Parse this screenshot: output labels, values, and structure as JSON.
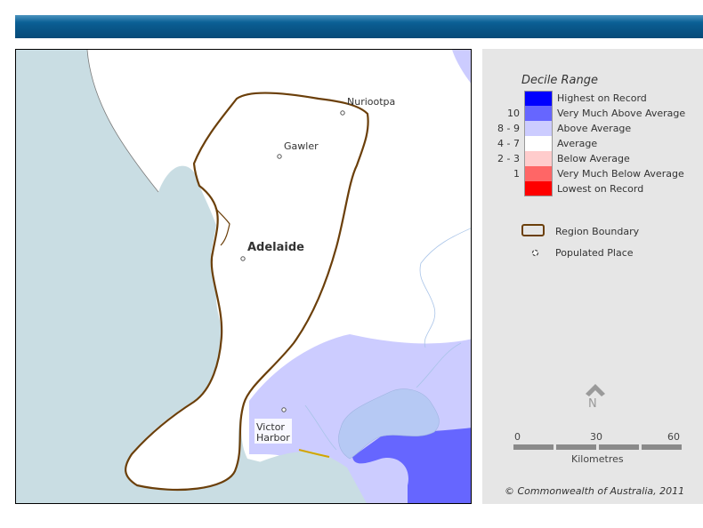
{
  "map": {
    "places": [
      {
        "name": "Nuriootpa"
      },
      {
        "name": "Gawler"
      },
      {
        "name": "Adelaide"
      },
      {
        "name": "Victor Harbor"
      }
    ],
    "colors": {
      "sea": "#c9dde3",
      "land": "#ffffff",
      "above_average": "#ccccff",
      "very_much_above_average": "#6666ff",
      "lake": "#b6c9f4",
      "boundary": "#6b3f0a"
    }
  },
  "legend": {
    "title": "Decile Range",
    "deciles": [
      {
        "range": "",
        "label": "Highest on Record",
        "color": "#0000ff"
      },
      {
        "range": "10",
        "label": "Very Much Above Average",
        "color": "#6666ff"
      },
      {
        "range": "8 - 9",
        "label": "Above Average",
        "color": "#ccccff"
      },
      {
        "range": "4 - 7",
        "label": "Average",
        "color": "#ffffff"
      },
      {
        "range": "2 - 3",
        "label": "Below Average",
        "color": "#ffcccc"
      },
      {
        "range": "1",
        "label": "Very Much Below Average",
        "color": "#ff6666"
      },
      {
        "range": "",
        "label": "Lowest on Record",
        "color": "#ff0000"
      }
    ],
    "region_boundary_label": "Region Boundary",
    "populated_place_label": "Populated Place",
    "north_label": "N",
    "scale": {
      "ticks": [
        "0",
        "30",
        "60"
      ],
      "unit": "Kilometres"
    },
    "copyright": "© Commonwealth of Australia, 2011"
  }
}
